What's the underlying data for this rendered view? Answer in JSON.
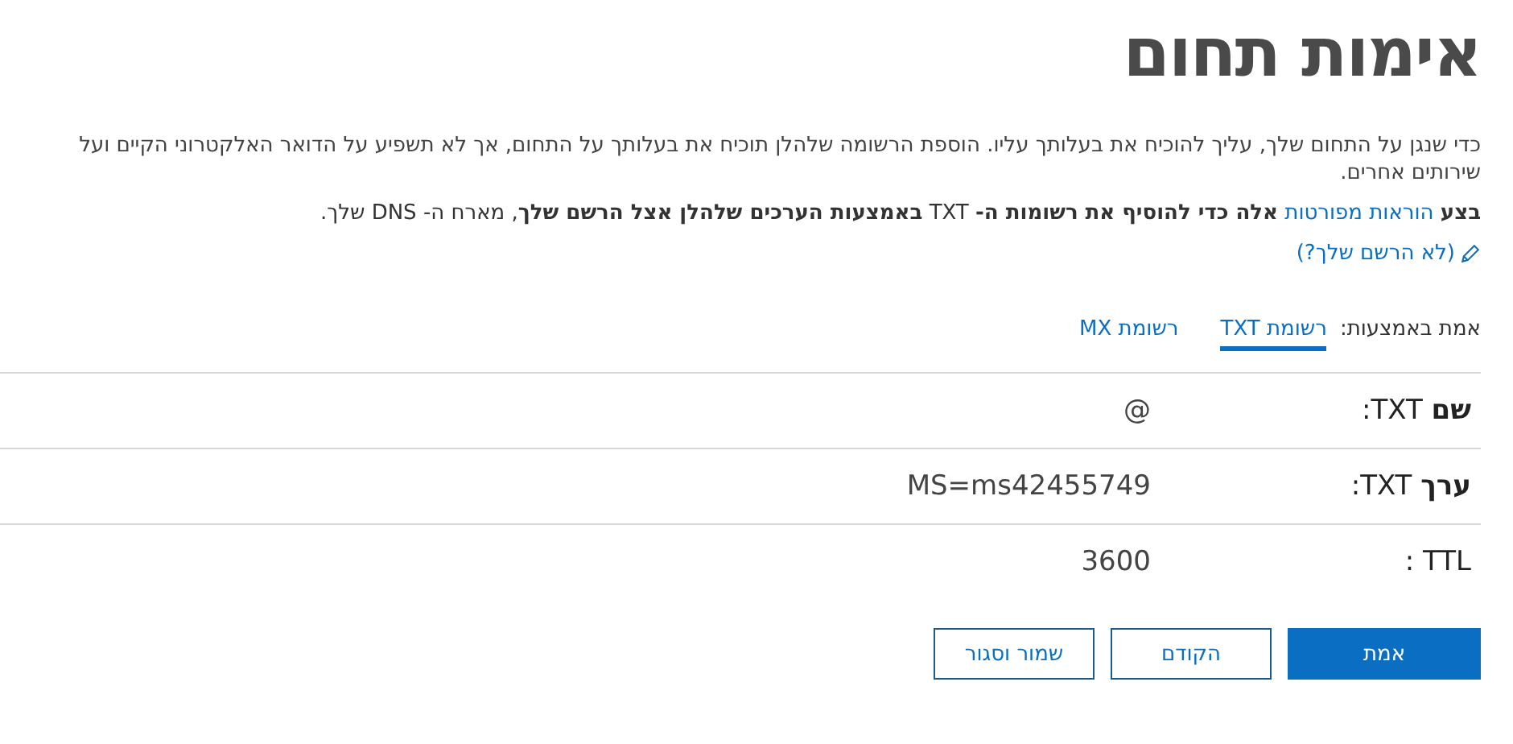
{
  "title": "אימות תחום",
  "description": "כדי שנגן על התחום שלך, עליך להוכיח את בעלותך עליו. הוספת הרשומה שלהלן תוכיח את בעלותך על התחום, אך לא תשפיע על הדואר האלקטרוני הקיים ועל שירותים אחרים.",
  "instruction": {
    "before": "**בצע**",
    "link": "הוראות מפורטות",
    "after": "**אלה כדי להוסיף את רשומות ה-** TXT **באמצעות הערכים שלהלן אצל הרשם שלך**, מארח ה- DNS שלך."
  },
  "registrar_link": "(לא הרשם שלך?)",
  "verify_by": {
    "label": "אמת באמצעות:",
    "tabs": [
      {
        "label": "רשומת TXT",
        "selected": true
      },
      {
        "label": "רשומת MX",
        "selected": false
      }
    ]
  },
  "records": [
    {
      "label": "**שם** TXT:",
      "value": "@"
    },
    {
      "label": "**ערך** TXT:",
      "value": "MS=ms42455749"
    },
    {
      "label": "TTL :",
      "value": "3600"
    }
  ],
  "buttons": [
    {
      "label": "אמת",
      "kind": "primary"
    },
    {
      "label": "הקודם",
      "kind": "secondary"
    },
    {
      "label": "שמור וסגור",
      "kind": "secondary"
    }
  ]
}
